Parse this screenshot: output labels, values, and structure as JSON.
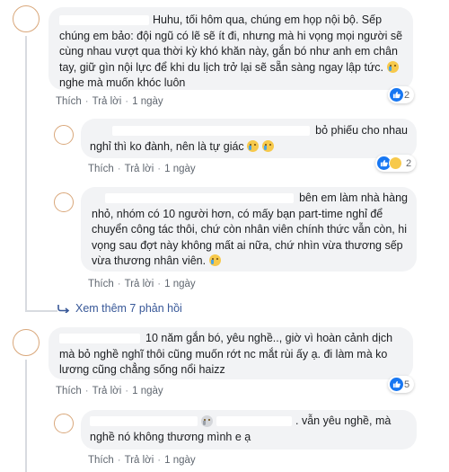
{
  "comments": [
    {
      "text": "Huhu, tối hôm qua, chúng em họp nội bộ. Sếp chúng em bảo: đội ngũ có lẽ sẽ ít đi, nhưng mà hi vọng mọi người sẽ cùng nhau vượt qua thời kỳ khó khăn này, gắn bó như anh em chân tay, giữ gìn nội lực để khi du lịch trở lại sẽ sẵn sàng ngay lập tức.",
      "text_tail": "nghe mà muốn khóc luôn",
      "like": "Thích",
      "reply": "Trả lời",
      "time": "1 ngày",
      "reaction_count": "2"
    },
    {
      "text_line1": "bỏ phiếu cho nhau",
      "text_line2": "nghỉ thì ko đành, nên là tự giác",
      "like": "Thích",
      "reply": "Trả lời",
      "time": "1 ngày",
      "reaction_count": "2"
    },
    {
      "text_line1": "bên em làm nhà hàng",
      "text_rest": "nhỏ, nhóm có 10 người hơn, có mấy bạn part-time nghỉ để chuyển công tác thôi, chứ còn nhân viên chính thức vẫn còn, hi vọng sau đợt này không mất ai nữa, chứ nhìn vừa thương sếp vừa thương nhân viên.",
      "like": "Thích",
      "reply": "Trả lời",
      "time": "1 ngày"
    },
    {
      "text_line1": "10 năm gắn bó, yêu nghề.., giờ vì hoàn cảnh dịch",
      "text_rest": "mà bỏ nghề nghĩ thôi cũng muốn rớt nc mắt rùi ấy ạ. đi làm mà ko lương cũng chẳng sống nổi haizz",
      "like": "Thích",
      "reply": "Trả lời",
      "time": "1 ngày",
      "reaction_count": "5"
    },
    {
      "text_line1": ". vẫn yêu nghề, mà",
      "text_line2": "nghề nó không thương mình e ạ",
      "like": "Thích",
      "reply": "Trả lời",
      "time": "1 ngày"
    }
  ],
  "see_more": "Xem thêm 7 phản hồi",
  "colors": {
    "link": "#385898",
    "bubble": "#f2f3f5",
    "like_blue": "#1877f2",
    "avatar_ring": "#d9a77a"
  }
}
